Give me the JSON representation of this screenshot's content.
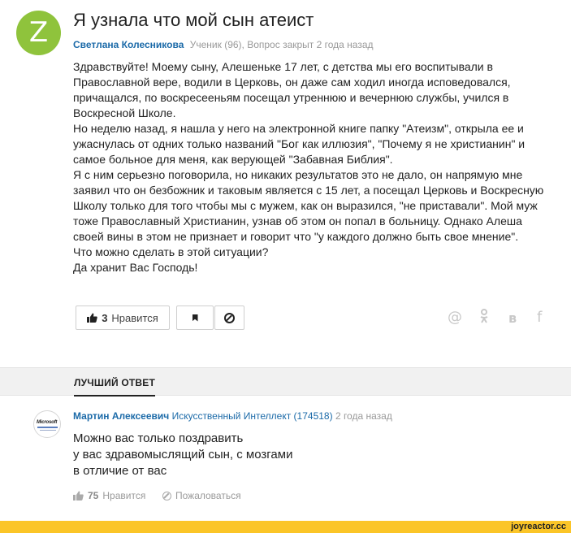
{
  "question": {
    "avatar_letter": "Z",
    "avatar_color": "#8fc33c",
    "title": "Я узнала что мой сын атеист",
    "author": "Светлана Колесникова",
    "meta": "Ученик (96), Вопрос закрыт 2 года назад",
    "body_lines": [
      "Здравствуйте! Моему сыну, Алешеньке 17 лет, с детства мы его воспитывали в",
      "Православной вере, водили в Церковь, он даже сам ходил иногда исповедовался,",
      "причащался, по воскресееньям посещал утреннюю и вечернюю службы, учился в",
      "Воскресной Школе.",
      "Но неделю назад, я нашла у него на электронной книге папку \"Атеизм\", открыла ее и",
      "ужаснулась от одних только названий \"Бог как иллюзия\", \"Почему я не христианин\" и",
      "самое больное для меня, как верующей \"Забавная Библия\".",
      "Я с ним серьезно поговорила, но никаких результатов это не дало, он напрямую мне",
      "заявил что он безбожник и таковым является с 15 лет, а посещал Церковь и Воскресную",
      "Школу только для того чтобы мы с мужем, как он выразился, \"не приставали\". Мой муж",
      "тоже Православный Христианин, узнав об этом он попал в больницу. Однако Алеша",
      "своей вины в этом не признает и говорит что \"у каждого должно быть свое мнение\".",
      "Что можно сделать в этой ситуации?",
      "Да хранит Вас Господь!"
    ],
    "like_count": "3",
    "like_label": "Нравится"
  },
  "share": {
    "mail": "@",
    "ok": "ꆜ",
    "vk": "в",
    "fb": "f"
  },
  "best_answer": {
    "section_label": "ЛУЧШИЙ ОТВЕТ",
    "avatar_text": "Microsoft",
    "author": "Мартин Алексеевич",
    "rank": "Искусственный Интеллект (174518)",
    "time": "2 года назад",
    "body_lines": [
      "Можно вас только поздравить",
      "у вас здравомыслящий сын, с мозгами",
      "в отличие от вас"
    ],
    "like_count": "75",
    "like_label": "Нравится",
    "report_label": "Пожаловаться"
  },
  "footer": {
    "brand": "joyreactor.cc",
    "color": "#fbc528"
  }
}
